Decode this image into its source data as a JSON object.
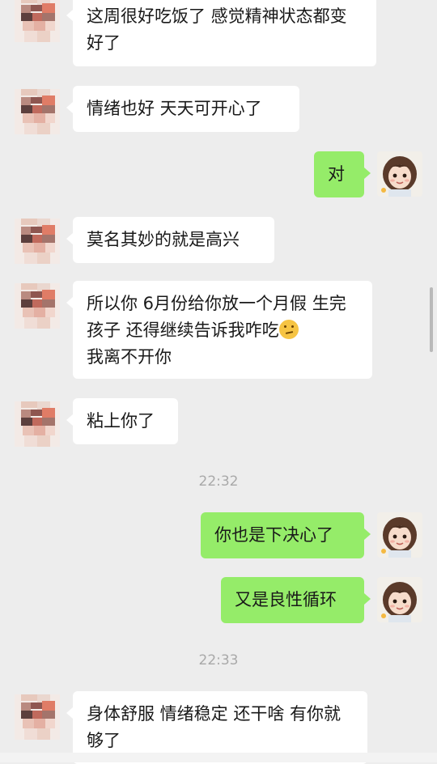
{
  "messages": [
    {
      "text": "这周很好吃饭了 感觉精神状态都变好了"
    },
    {
      "text": "情绪也好 天天可开心了"
    },
    {
      "text": "对"
    },
    {
      "text": "莫名其妙的就是高兴"
    },
    {
      "text_a": "所以你 6月份给你放一个月假 生完孩子 还得继续告诉我咋吃",
      "emoji": "thinking-face-emoji",
      "text_b": "我离不开你"
    },
    {
      "text": "粘上你了"
    },
    {
      "time": "22:32"
    },
    {
      "text": "你也是下决心了"
    },
    {
      "text": "又是良性循环"
    },
    {
      "time": "22:33"
    },
    {
      "text": "身体舒服 情绪稳定 还干啥 有你就够了"
    }
  ],
  "colors": {
    "background": "#ededed",
    "incoming_bubble": "#ffffff",
    "outgoing_bubble": "#95ec69",
    "timestamp": "#a9a9a9"
  }
}
